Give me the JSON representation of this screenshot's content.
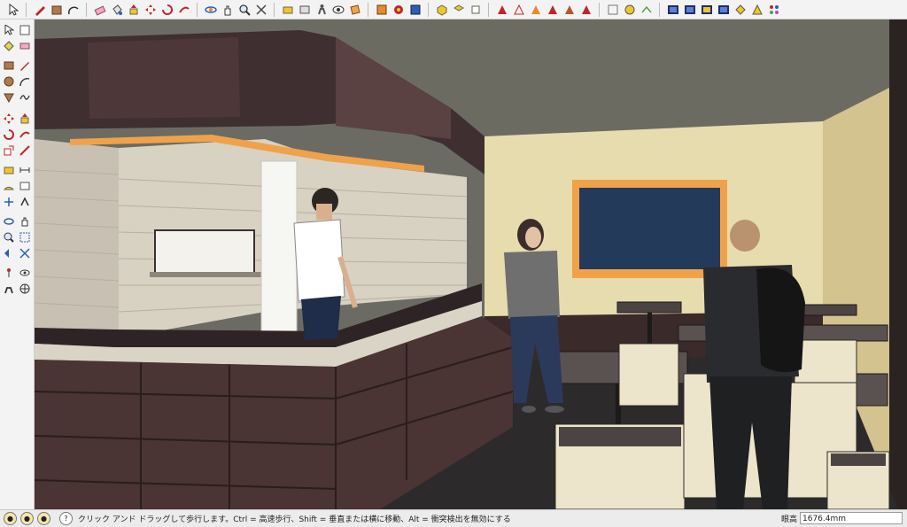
{
  "toolbar": {
    "icons": [
      "select-icon",
      "pencil-icon",
      "rectangle-icon",
      "arc-icon",
      "eraser-icon",
      "paint-bucket-icon",
      "push-pull-icon",
      "move-icon",
      "rotate-icon",
      "follow-me-icon",
      "orbit-icon",
      "pan-icon",
      "zoom-icon",
      "zoom-extents-icon",
      "tape-measure-icon",
      "position-camera-icon",
      "walk-icon",
      "look-around-icon",
      "section-plane-icon",
      "components-icon",
      "materials-icon",
      "styles-icon",
      "view-iso-icon",
      "view-top-icon",
      "view-front-icon",
      "view-right-icon",
      "view-back-icon",
      "view-left-icon",
      "xray-icon",
      "wireframe-icon",
      "hidden-line-icon",
      "shaded-icon",
      "shaded-texture-icon",
      "monochrome-icon",
      "layers-icon"
    ],
    "colors": {
      "accent_red": "#c0262b",
      "accent_orange": "#e48a2f",
      "accent_yellow": "#f0c62c",
      "accent_blue": "#2b5fb8"
    }
  },
  "left_tools": [
    "select-icon",
    "eraser-icon",
    "paint-icon",
    "pencil-icon",
    "rectangle-icon",
    "arc-icon",
    "circle-icon",
    "polygon-icon",
    "freehand-icon",
    "move-icon",
    "push-pull-icon",
    "rotate-icon",
    "offset-icon",
    "scale-icon",
    "follow-me-icon",
    "tape-icon",
    "text-icon",
    "protractor-icon",
    "dimension-icon",
    "axes-icon",
    "3d-text-icon",
    "orbit-icon",
    "pan-icon",
    "zoom-icon",
    "zoom-window-icon",
    "previous-view-icon",
    "zoom-extents-icon",
    "position-camera-icon",
    "look-around-icon",
    "walk-icon",
    "section-icon"
  ],
  "scene": {
    "wall_color": "#e6dcae",
    "ceiling_color": "#6c6b62",
    "counter_color": "#4a3434",
    "blackboard_color": "#233a5a",
    "frame_color": "#f0a24a",
    "furniture_color": "#ece5cc"
  },
  "status": {
    "message": "クリック アンド ドラッグして歩行します。Ctrl = 高速歩行、Shift = 垂直または横に移動、Alt = 衝突検出を無効にする",
    "measure_label": "眼高",
    "measure_value": "1676.4mm"
  }
}
